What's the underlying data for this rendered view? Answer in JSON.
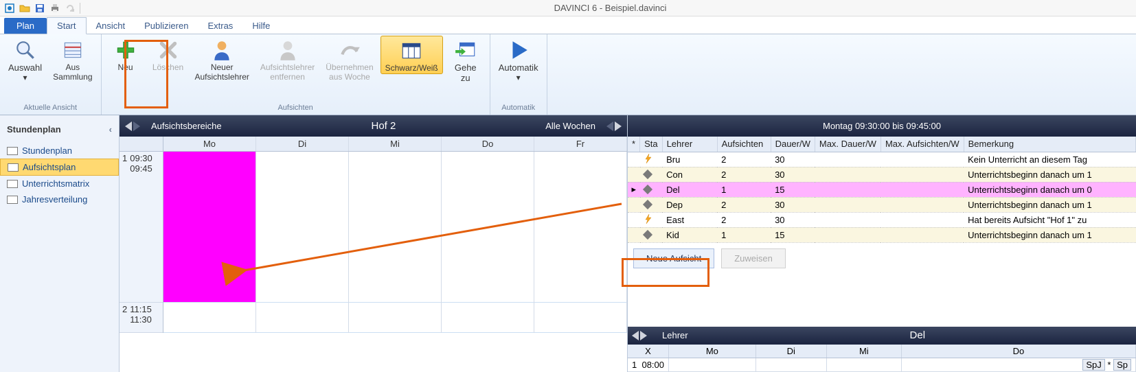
{
  "app": {
    "title": "DAVINCI 6 - Beispiel.davinci"
  },
  "tabs": {
    "plan": "Plan",
    "start": "Start",
    "ansicht": "Ansicht",
    "publizieren": "Publizieren",
    "extras": "Extras",
    "hilfe": "Hilfe"
  },
  "ribbon": {
    "group_aktuell": "Aktuelle Ansicht",
    "auswahl": "Auswahl",
    "aussammlung": "Aus\nSammlung",
    "neu": "Neu",
    "loeschen": "Löschen",
    "neuer_al": "Neuer\nAufsichtslehrer",
    "al_entfernen": "Aufsichtslehrer\nentfernen",
    "uebernehmen": "Übernehmen\naus Woche",
    "group_aufsichten": "Aufsichten",
    "schwarzweiss": "Schwarz/Weiß",
    "gehezu": "Gehe\nzu",
    "automatik": "Automatik",
    "group_automatik": "Automatik"
  },
  "sidebar": {
    "header": "Stundenplan",
    "items": {
      "stundenplan": "Stundenplan",
      "aufsichtsplan": "Aufsichtsplan",
      "umatrix": "Unterrichtsmatrix",
      "jahresv": "Jahresverteilung"
    }
  },
  "schedule": {
    "bar_label": "Aufsichtsbereiche",
    "bar_center": "Hof 2",
    "bar_right": "Alle Wochen",
    "days": {
      "mo": "Mo",
      "di": "Di",
      "mi": "Mi",
      "do": "Do",
      "fr": "Fr"
    },
    "slots": [
      {
        "n": "1",
        "from": "09:30",
        "to": "09:45"
      },
      {
        "n": "2",
        "from": "11:15",
        "to": "11:30"
      }
    ]
  },
  "rightbar": {
    "title": "Montag 09:30:00 bis 09:45:00"
  },
  "table": {
    "headers": {
      "sta": "Sta",
      "lehrer": "Lehrer",
      "aufsichten": "Aufsichten",
      "dauerw": "Dauer/W",
      "maxdauerw": "Max. Dauer/W",
      "maxaufsw": "Max. Aufsichten/W",
      "bemerkung": "Bemerkung",
      "star": "*"
    },
    "rows": [
      {
        "icon": "bolt",
        "lehrer": "Bru",
        "auf": "2",
        "dauer": "30",
        "bem": "Kein Unterricht an diesem Tag"
      },
      {
        "icon": "diamond",
        "lehrer": "Con",
        "auf": "2",
        "dauer": "30",
        "bem": "Unterrichtsbeginn danach um 1"
      },
      {
        "icon": "diamond",
        "lehrer": "Del",
        "auf": "1",
        "dauer": "15",
        "bem": "Unterrichtsbeginn danach um 0",
        "sel": true
      },
      {
        "icon": "diamond",
        "lehrer": "Dep",
        "auf": "2",
        "dauer": "30",
        "bem": "Unterrichtsbeginn danach um 1"
      },
      {
        "icon": "bolt",
        "lehrer": "East",
        "auf": "2",
        "dauer": "30",
        "bem": "Hat bereits Aufsicht \"Hof 1\" zu"
      },
      {
        "icon": "diamond",
        "lehrer": "Kid",
        "auf": "1",
        "dauer": "15",
        "bem": "Unterrichtsbeginn danach um 1"
      }
    ]
  },
  "buttons": {
    "neue_aufsicht": "Neue Aufsicht",
    "zuweisen": "Zuweisen"
  },
  "lowerbar": {
    "label": "Lehrer",
    "center": "Del"
  },
  "lowertable": {
    "headers": {
      "x": "X",
      "mo": "Mo",
      "di": "Di",
      "mi": "Mi",
      "do": "Do"
    },
    "row": {
      "n": "1",
      "time": "08:00",
      "spj1": "SpJ",
      "spj2": "Sp",
      "star": "*"
    }
  }
}
